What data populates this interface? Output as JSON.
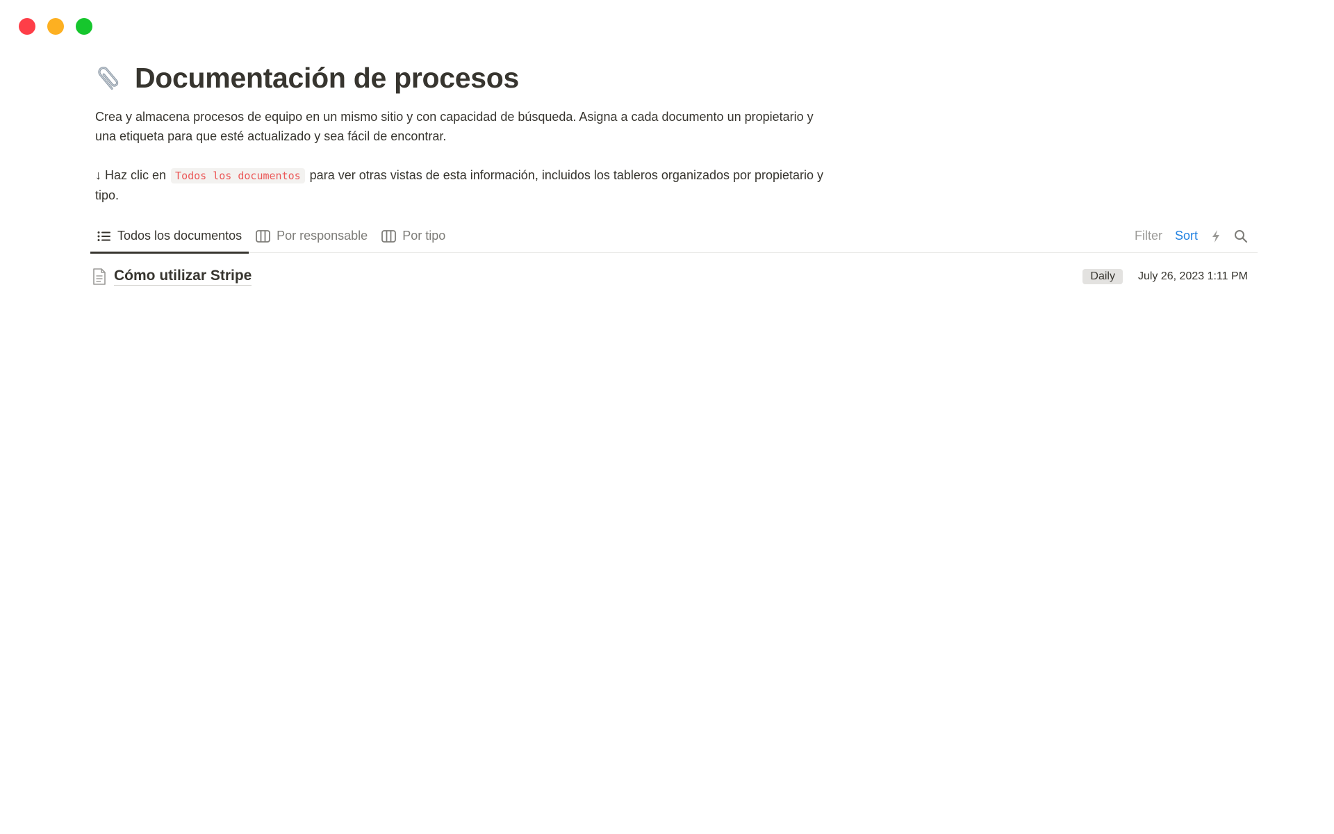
{
  "window": {
    "controls": [
      "close",
      "minimize",
      "maximize"
    ]
  },
  "page": {
    "icon": "paperclip-icon",
    "title": "Documentación de procesos",
    "description_line1": "Crea y almacena procesos de equipo en un mismo sitio y con capacidad de búsqueda. Asigna a cada documento un propietario y una etiqueta para que esté actualizado y sea fácil de encontrar.",
    "hint_arrow": "↓",
    "hint_before": " Haz clic en ",
    "hint_code": "Todos los documentos",
    "hint_after": " para ver otras vistas de esta información, incluidos los tableros organizados por propietario y tipo."
  },
  "views": {
    "tabs": [
      {
        "label": "Todos los documentos",
        "icon": "list-icon",
        "active": true
      },
      {
        "label": "Por responsable",
        "icon": "board-icon",
        "active": false
      },
      {
        "label": "Por tipo",
        "icon": "board-icon",
        "active": false
      }
    ],
    "toolbar": {
      "filter_label": "Filter",
      "sort_label": "Sort",
      "automation_icon": "lightning-icon",
      "search_icon": "search-icon"
    }
  },
  "rows": [
    {
      "icon": "document-icon",
      "title": "Cómo utilizar Stripe",
      "tag": "Daily",
      "date": "July 26, 2023 1:11 PM"
    }
  ],
  "colors": {
    "accent": "#2383e2",
    "code_text": "#eb5757",
    "tag_bg": "#e3e2e0"
  }
}
